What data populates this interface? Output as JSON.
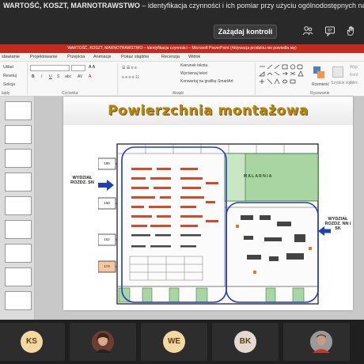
{
  "meeting": {
    "title_bold": "WARTOŚĆ, KOSZT, MARNOTRAWSTWO",
    "title_rest": " – identyfikacja czynności i ich pomiar przy użyciu ogólnodostępnych narzędzi informatycznych",
    "take_control_label": "Zażądaj kontroli"
  },
  "powerpoint": {
    "titlebar_text": "WARTOŚĆ, KOSZT, MARNOTRAWSTWO – identyfikacja czynności – Microsoft PowerPoint (Aktywacja produktu nie powiodła się)",
    "tabs": [
      "stawianie",
      "Projektowanie",
      "Przejścia",
      "Animacje",
      "Pokaz slajdów",
      "Recenzja",
      "Widok"
    ],
    "ribbon": {
      "slides_items": [
        "Układ",
        "Resetuj",
        "Sekcja"
      ],
      "slides_label": "lajdy",
      "font_label": "Czcionka",
      "paragraph_items": [
        "Kierunek tekstu",
        "Wyrównaj tekst",
        "Konwertuj na grafikę SmartArt"
      ],
      "paragraph_label": "Akapit",
      "arrange_label": "Rozmieść",
      "styles_label": "Szybkie style",
      "drawing_label": "Rysowanie",
      "extra_items": [
        "Wyp",
        "Kont",
        "Efek"
      ]
    }
  },
  "slide": {
    "title": "Powierzchnia montażowa",
    "left_label": "WYDZIAŁ ROZDZ. SN",
    "right_label": "WYDZIAŁ ROZDZ. NN I SK",
    "hall_label": "M A L A R N I A",
    "numbers": [
      "180",
      "160",
      "162",
      "174"
    ]
  },
  "participants": [
    {
      "initials": "KS"
    },
    {
      "initials": ""
    },
    {
      "initials": "WE"
    },
    {
      "initials": "BK"
    },
    {
      "initials": ""
    }
  ]
}
